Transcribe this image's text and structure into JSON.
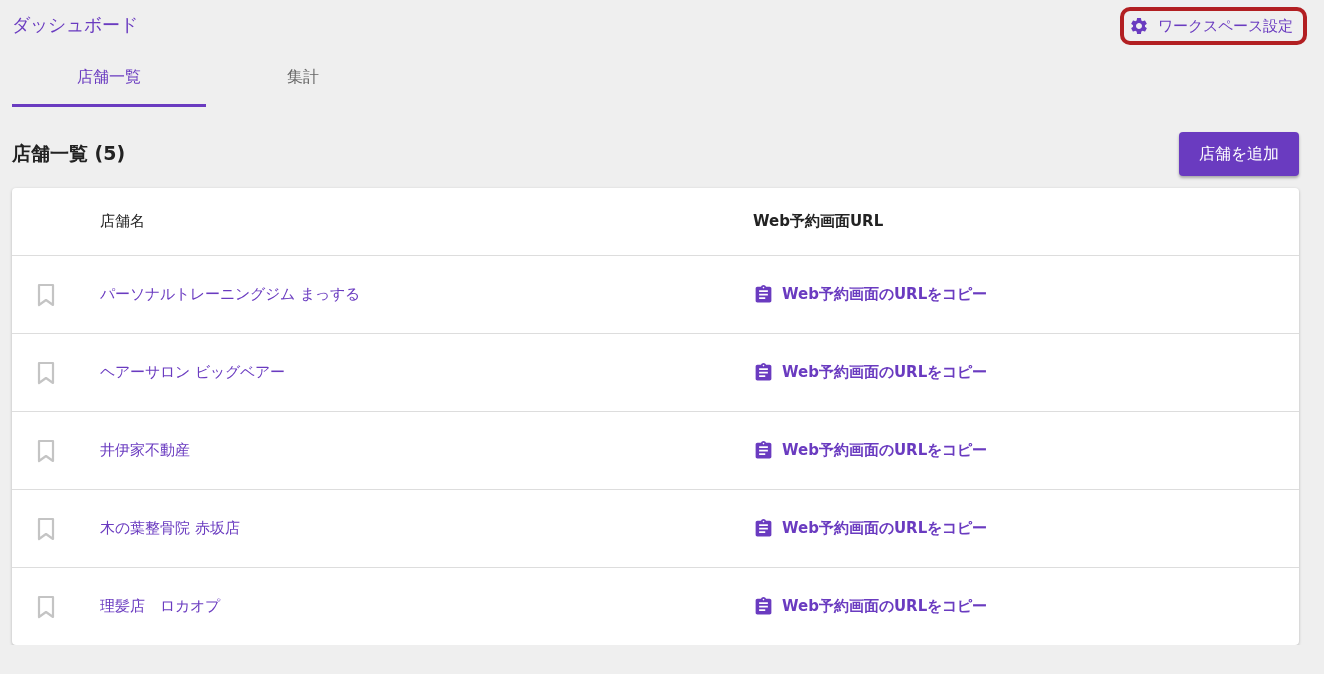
{
  "header": {
    "title": "ダッシュボード",
    "settings_button": {
      "label": "ワークスペース設定",
      "highlighted": true
    }
  },
  "tabs": [
    {
      "label": "店舗一覧",
      "selected": true
    },
    {
      "label": "集計",
      "selected": false
    }
  ],
  "section": {
    "heading": "店舗一覧 (5)",
    "add_button": "店舗を追加"
  },
  "table": {
    "columns": [
      "店舗名",
      "Web予約画面URL"
    ],
    "rows": [
      {
        "bookmarked": false,
        "name": "パーソナルトレーニングジム まっする",
        "url_link": "Web予約画面のURLをコピー"
      },
      {
        "bookmarked": false,
        "name": "ヘアーサロン ビッグベアー",
        "url_link": "Web予約画面のURLをコピー"
      },
      {
        "bookmarked": false,
        "name": "井伊家不動産",
        "url_link": "Web予約画面のURLをコピー"
      },
      {
        "bookmarked": false,
        "name": "木の葉整骨院 赤坂店",
        "url_link": "Web予約画面のURLをコピー"
      },
      {
        "bookmarked": false,
        "name": "理髪店　ロカオプ",
        "url_link": "Web予約画面のURLをコピー"
      }
    ]
  }
}
